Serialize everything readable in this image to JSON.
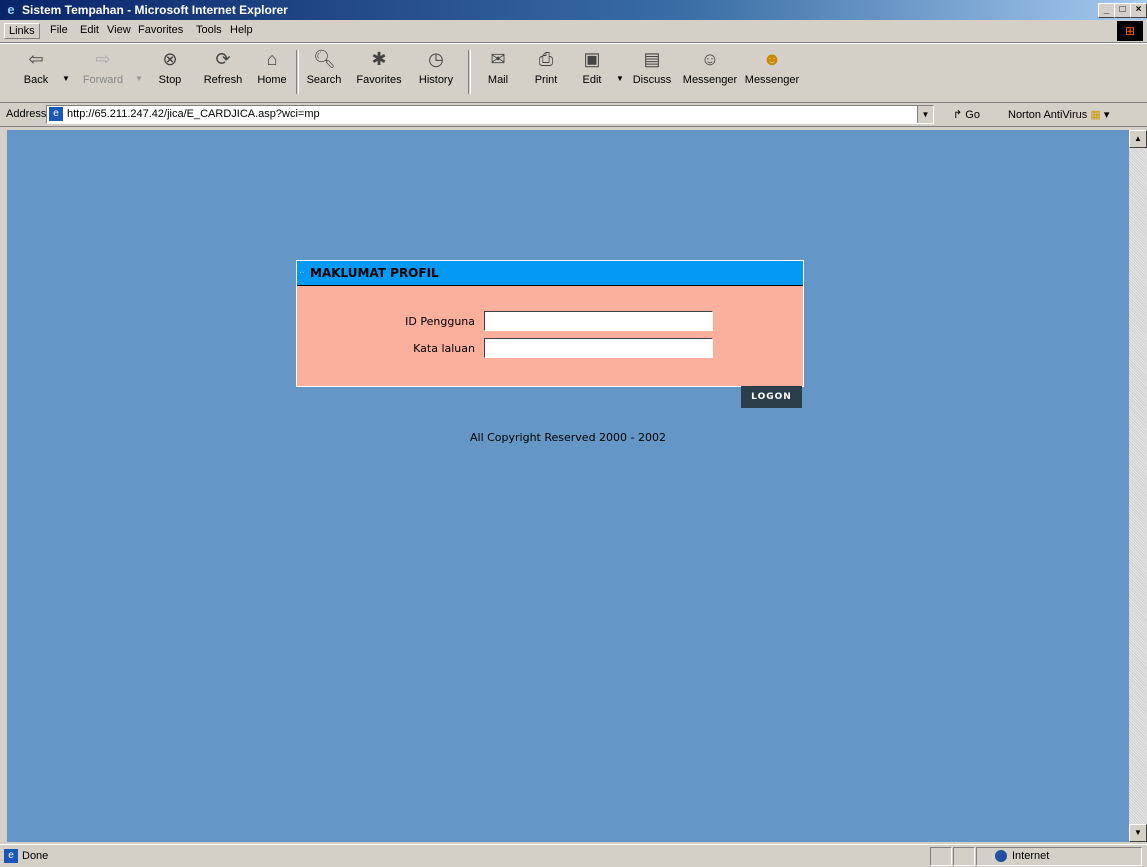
{
  "window": {
    "title": "Sistem Tempahan - Microsoft Internet Explorer"
  },
  "menubar": {
    "links": "Links",
    "items": [
      "File",
      "Edit",
      "View",
      "Favorites",
      "Tools",
      "Help"
    ]
  },
  "toolbar": {
    "buttons": [
      "Back",
      "Forward",
      "Stop",
      "Refresh",
      "Home",
      "Search",
      "Favorites",
      "History",
      "Mail",
      "Print",
      "Edit",
      "Discuss",
      "Messenger",
      "Messenger"
    ]
  },
  "address": {
    "label": "Address",
    "url": "http://65.211.247.42/jica/E_CARDJICA.asp?wci=mp",
    "go": "Go",
    "norton": "Norton AntiVirus"
  },
  "page": {
    "panel_title": "MAKLUMAT PROFIL",
    "user_label": "ID Pengguna",
    "password_label": "Kata laluan",
    "user_value": "",
    "password_value": "",
    "logon_label": "LOGON",
    "copyright": "All Copyright Reserved 2000 - 2002"
  },
  "status": {
    "text": "Done",
    "zone": "Internet"
  }
}
